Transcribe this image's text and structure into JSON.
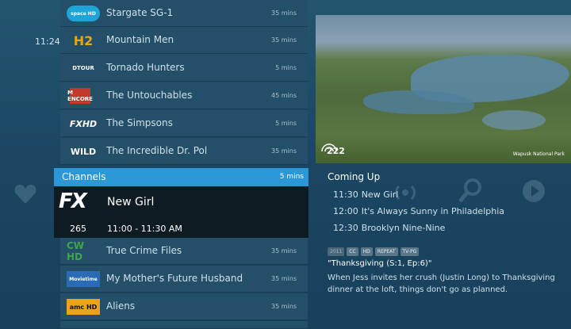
{
  "clock": "11:24",
  "guide": {
    "rows_top": [
      {
        "logo": "space HD",
        "logo_color": "#1ea5d8",
        "title": "Stargate SG-1",
        "duration": "35 mins"
      },
      {
        "logo": "H2",
        "logo_color": "#c88a1a",
        "title": "Mountain Men",
        "duration": "35 mins"
      },
      {
        "logo": "DTOUR",
        "logo_color": "#234f68",
        "title": "Tornado Hunters",
        "duration": "5 mins"
      },
      {
        "logo": "M ENCORE",
        "logo_color": "#c0392b",
        "title": "The Untouchables",
        "duration": "45 mins"
      },
      {
        "logo": "FXHD",
        "logo_color": "#234f68",
        "title": "The Simpsons",
        "duration": "5 mins"
      },
      {
        "logo": "WILD",
        "logo_color": "#234f68",
        "title": "The Incredible Dr. Pol",
        "duration": "35 mins"
      }
    ],
    "channels_label": "Channels",
    "channels_duration": "5 mins",
    "selected": {
      "logo": "FX",
      "title": "New Girl",
      "number": "265",
      "time": "11:00 - 11:30 AM"
    },
    "rows_bottom": [
      {
        "logo": "CW HD",
        "logo_color": "#2f8a3a",
        "title": "True Crime Files",
        "duration": "35 mins"
      },
      {
        "logo": "Movietime",
        "logo_color": "#2a6bb5",
        "title": "My Mother's Future Husband",
        "duration": "35 mins"
      },
      {
        "logo": "amc HD",
        "logo_color": "#e8a51c",
        "title": "Aliens",
        "duration": "35 mins"
      }
    ]
  },
  "preview": {
    "channel_badge": "222",
    "caption": "Wapusk National Park"
  },
  "coming_up": {
    "title": "Coming Up",
    "items": [
      {
        "time": "11:30",
        "title": "New Girl"
      },
      {
        "time": "12:00",
        "title": "It's Always Sunny in Philadelphia"
      },
      {
        "time": "12:30",
        "title": "Brooklyn Nine-Nine"
      }
    ]
  },
  "details": {
    "badges": [
      "2011",
      "CC",
      "HD",
      "REPEAT",
      "TV-PG"
    ],
    "episode_title": "\"Thanksgiving (S:1, Ep:6)\"",
    "description": "When Jess invites her crush (Justin Long) to Thanksgiving dinner at the loft, things don't go as planned."
  },
  "icons": [
    "heart-icon",
    "radio-icon",
    "search-icon",
    "play-icon"
  ]
}
